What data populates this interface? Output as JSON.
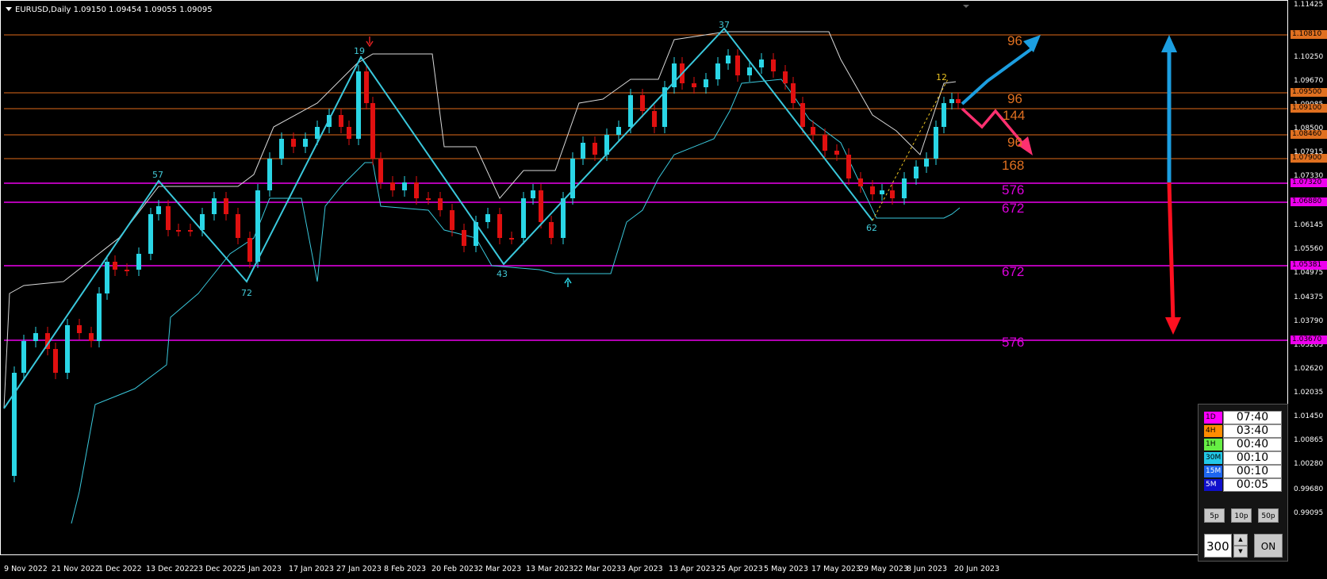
{
  "chart": {
    "symbol_line": "EURUSD,Daily  1.09150 1.09454 1.09055 1.09095"
  },
  "colors": {
    "background": "#000000",
    "bull_candle": "#2ad6e6",
    "bear_candle": "#e01010",
    "zigzag": "#3ac8dc",
    "channel_upper": "#d8d8d8",
    "channel_lower": "#3ac8dc",
    "orange_level": "#e06a1a",
    "magenta_level": "#ee00ee",
    "blue_arrow": "#1c9ee0",
    "red_arrow": "#ff1020",
    "pink_projection": "#ff3070"
  },
  "price_axis": {
    "ticks": [
      "1.11425",
      "1.10250",
      "1.09670",
      "1.09085",
      "1.08500",
      "1.07915",
      "1.07330",
      "1.06730",
      "1.06145",
      "1.05560",
      "1.04975",
      "1.04375",
      "1.03790",
      "1.03205",
      "1.02620",
      "1.02035",
      "1.01450",
      "1.00865",
      "1.00280",
      "0.99680",
      "0.99095"
    ],
    "price_tags": [
      {
        "label": "1.10810",
        "color": "orange"
      },
      {
        "label": "1.09500",
        "color": "orange"
      },
      {
        "label": "1.09100",
        "color": "orange"
      },
      {
        "label": "1.08460",
        "color": "orange"
      },
      {
        "label": "1.07900",
        "color": "orange"
      },
      {
        "label": "1.07320",
        "color": "magenta"
      },
      {
        "label": "1.06880",
        "color": "magenta"
      },
      {
        "label": "1.05381",
        "color": "magenta"
      },
      {
        "label": "1.03670",
        "color": "magenta"
      }
    ]
  },
  "time_axis": {
    "labels": [
      "9 Nov 2022",
      "21 Nov 2022",
      "1 Dec 2022",
      "13 Dec 2022",
      "23 Dec 2022",
      "5 Jan 2023",
      "17 Jan 2023",
      "27 Jan 2023",
      "8 Feb 2023",
      "20 Feb 2023",
      "2 Mar 2023",
      "13 Mar 2023",
      "22 Mar 2023",
      "3 Apr 2023",
      "13 Apr 2023",
      "25 Apr 2023",
      "5 May 2023",
      "17 May 2023",
      "29 May 2023",
      "8 Jun 2023",
      "20 Jun 2023"
    ]
  },
  "fib_labels": [
    {
      "text": "96",
      "color": "orange"
    },
    {
      "text": "96",
      "color": "orange"
    },
    {
      "text": "144",
      "color": "orange"
    },
    {
      "text": "96",
      "color": "orange"
    },
    {
      "text": "168",
      "color": "orange"
    },
    {
      "text": "576",
      "color": "magenta"
    },
    {
      "text": "672",
      "color": "magenta"
    },
    {
      "text": "672",
      "color": "magenta"
    },
    {
      "text": "576",
      "color": "magenta"
    }
  ],
  "zigzag_labels": [
    "57",
    "72",
    "19",
    "43",
    "37",
    "62",
    "12"
  ],
  "timer_panel": {
    "rows": [
      {
        "tf": "1D",
        "time": "07:40",
        "badge_color": "#ff00ff"
      },
      {
        "tf": "4H",
        "time": "03:40",
        "badge_color": "#ff8c00"
      },
      {
        "tf": "1H",
        "time": "00:40",
        "badge_color": "#66ee44"
      },
      {
        "tf": "30M",
        "time": "00:10",
        "badge_color": "#22c8e8"
      },
      {
        "tf": "15M",
        "time": "00:10",
        "badge_color": "#1e66ee"
      },
      {
        "tf": "5M",
        "time": "00:05",
        "badge_color": "#1010cc"
      }
    ],
    "pip_buttons": [
      "5p",
      "10p",
      "50p"
    ],
    "lot_value": "300",
    "spin_up": "▲",
    "spin_down": "▼",
    "toggle_label": "ON"
  }
}
